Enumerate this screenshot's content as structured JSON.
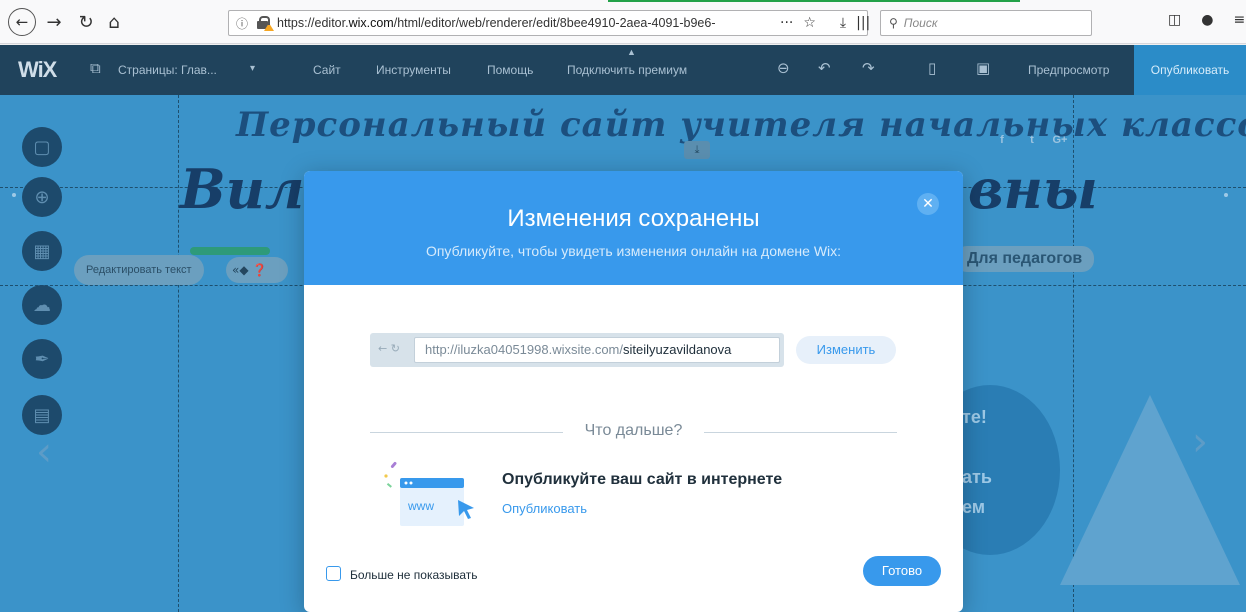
{
  "browser": {
    "url_prefix": "https://editor.",
    "url_domain": "wix.com",
    "url_rest": "/html/editor/web/renderer/edit/8bee4910-2aea-4091-b9e6-",
    "search_placeholder": "Поиск",
    "accent_color": "#23a249"
  },
  "editor_bar": {
    "logo": "WiX",
    "pages": "Страницы: Глав...",
    "menu": [
      "Сайт",
      "Инструменты",
      "Помощь",
      "Подключить премиум"
    ],
    "preview": "Предпросмотр",
    "publish": "Опубликовать",
    "bar_color": "#20435c"
  },
  "canvas": {
    "site_title": "Персональный сайт учителя начальных классов",
    "name_left": "Вили",
    "name_right": "вны",
    "social": [
      "f",
      "t",
      "G+"
    ],
    "pedagog": "Для педагогов",
    "edit_text_tip": "Редактировать текст",
    "frag_1": "те!",
    "frag_2": "ать",
    "frag_3": "ем"
  },
  "modal": {
    "title": "Изменения сохранены",
    "subtitle": "Опубликуйте, чтобы увидеть изменения онлайн на домене Wix:",
    "url_host": "http://iluzka04051998.wixsite.com/",
    "url_slug": "siteilyuzavildanova",
    "change_label": "Изменить",
    "whats_next": "Что дальше?",
    "illus_text": "www",
    "publish_heading": "Опубликуйте ваш сайт в интернете",
    "publish_link": "Опубликовать",
    "checkbox_label": "Больше не показывать",
    "done_label": "Готово",
    "header_color": "#3899ec"
  }
}
